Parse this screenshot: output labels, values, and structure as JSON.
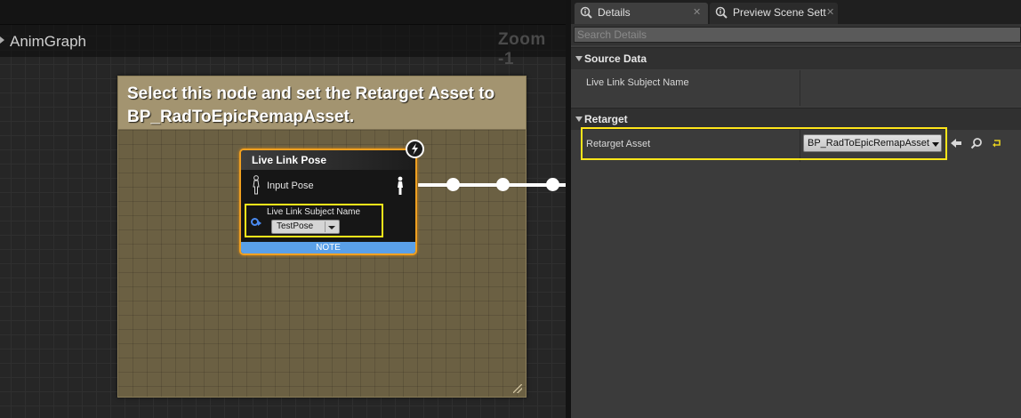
{
  "graph": {
    "title": "AnimGraph",
    "zoom": "Zoom -1",
    "comment": {
      "text": "Select this node and set the Retarget Asset to BP_RadToEpicRemapAsset."
    },
    "node": {
      "title": "Live Link Pose",
      "input_pose_label": "Input Pose",
      "subject_label": "Live Link Subject Name",
      "subject_value": "TestPose",
      "note_label": "NOTE"
    }
  },
  "details": {
    "tabs": [
      {
        "label": "Details",
        "icon": "info-icon",
        "active": true
      },
      {
        "label": "Preview Scene Sett",
        "icon": "info-icon",
        "active": false
      }
    ],
    "search": {
      "placeholder": "Search Details",
      "value": ""
    },
    "categories": [
      {
        "label": "Source Data",
        "properties": [
          {
            "label": "Live Link Subject Name",
            "value": ""
          }
        ]
      },
      {
        "label": "Retarget",
        "properties": [
          {
            "label": "Retarget Asset",
            "value": "BP_RadToEpicRemapAsset"
          }
        ]
      }
    ],
    "asset_buttons": [
      "use-selected-arrow-icon",
      "browse-magnifier-icon",
      "reset-to-default-icon"
    ]
  },
  "colors": {
    "highlight": "#ffe61a",
    "node_border": "#f0a020",
    "note_bar": "#5aa0e8",
    "comment_header": "#a39470",
    "comment_body": "#6b6043",
    "pin_blue": "#4a8af0"
  }
}
